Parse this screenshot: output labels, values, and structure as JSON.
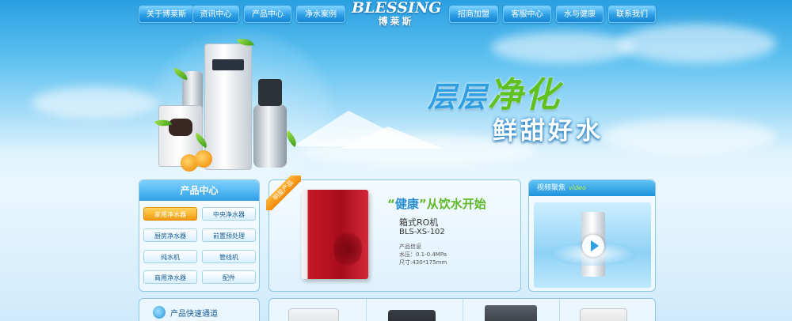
{
  "nav": {
    "left": [
      "关于博莱斯",
      "资讯中心",
      "产品中心",
      "净水案例"
    ],
    "right": [
      "招商加盟",
      "客服中心",
      "水与健康",
      "联系我们"
    ]
  },
  "logo": {
    "en": "BLESSING",
    "cn": "博莱斯"
  },
  "hero": {
    "slogan_line1_a": "层层",
    "slogan_line1_b": "净化",
    "slogan_line2": "鲜甜好水"
  },
  "product_center": {
    "title": "产品中心",
    "items": [
      "家用净水器",
      "中央净水器",
      "厨房净水器",
      "前置预处理",
      "纯水机",
      "管线机",
      "商用净水器",
      "配件"
    ],
    "active_index": 0
  },
  "feature": {
    "ribbon": "明星产品",
    "title_q1": "“",
    "title_main": "健康",
    "title_q2": "”",
    "title_tail": "从饮水开始",
    "name": "箱式RO机",
    "model": "BLS-XS-102",
    "info_label": "产品信息",
    "pressure": "水压：0.1-0.4MPa",
    "size": "尺寸:430*175mm"
  },
  "video": {
    "title_cn": "视频聚焦",
    "title_en": "video"
  },
  "quick": {
    "label": "产品快速通道"
  },
  "colors": {
    "accent": "#2e9fe0",
    "green": "#5fc21f",
    "orange": "#f29a10",
    "red": "#c51727"
  }
}
